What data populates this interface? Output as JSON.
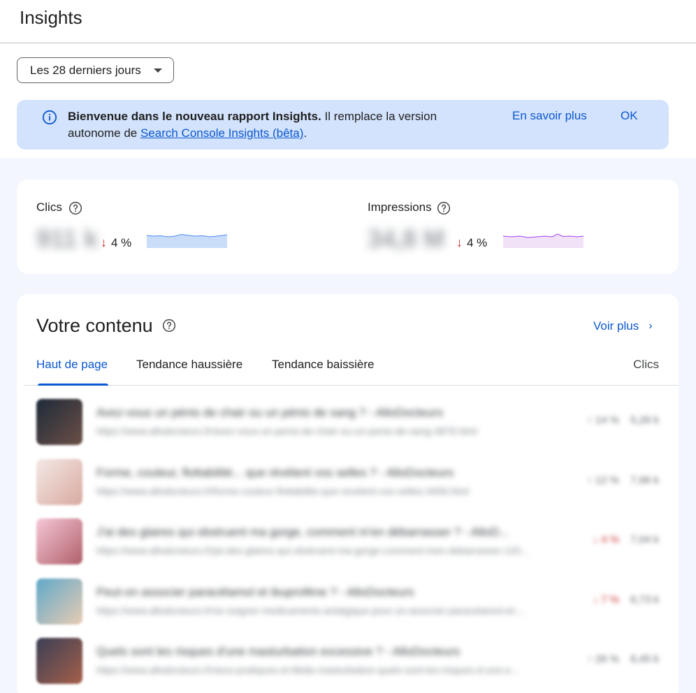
{
  "header": {
    "title": "Insights"
  },
  "filter": {
    "range_label": "Les 28 derniers jours"
  },
  "banner": {
    "bold_text": "Bienvenue dans le nouveau rapport Insights.",
    "text": " Il remplace la version autonome de ",
    "link_text": "Search Console Insights (bêta)",
    "trailing": ".",
    "learn_more": "En savoir plus",
    "ok": "OK"
  },
  "metrics": {
    "clicks": {
      "label": "Clics",
      "value": "911 k",
      "delta": "4 %",
      "direction": "down",
      "spark_color": "#c2d7f7"
    },
    "impressions": {
      "label": "Impressions",
      "value": "34,8 M",
      "delta": "4 %",
      "direction": "down",
      "spark_color": "#eedcf5"
    }
  },
  "content": {
    "title": "Votre contenu",
    "see_more": "Voir plus",
    "tabs": [
      {
        "label": "Haut de page"
      },
      {
        "label": "Tendance haussière"
      },
      {
        "label": "Tendance baissière"
      }
    ],
    "column_header": "Clics",
    "rows": [
      {
        "title": "Avez-vous un pénis de chair ou un pénis de sang ? - AlloDocteurs",
        "url": "https://www.allodocteurs.fr/avez-vous-un-penis-de-chair-ou-un-penis-de-sang-3876.html",
        "change": "↑ 14 %",
        "clicks": "5,26 k",
        "change_dir": "up",
        "thumb": [
          "#1e2a3a",
          "#6b4f45"
        ]
      },
      {
        "title": "Forme, couleur, flottabilité... que révèlent vos selles ? - AlloDocteurs",
        "url": "https://www.allodocteurs.fr/forme-couleur-flottabilite-que-revelent-vos-selles-3456.html",
        "change": "↑ 12 %",
        "clicks": "7,96 k",
        "change_dir": "up",
        "thumb": [
          "#f3e9e6",
          "#d9a9a0"
        ]
      },
      {
        "title": "J'ai des glaires qui obstruent ma gorge, comment m'en débarrasser ? - AlloD...",
        "url": "https://www.allodocteurs.fr/jai-des-glaires-qui-obstruent-ma-gorge-comment-men-debarrasser-120...",
        "change": "↓ 4 %",
        "clicks": "7,04 k",
        "change_dir": "down",
        "thumb": [
          "#f6c7d6",
          "#b0606b"
        ]
      },
      {
        "title": "Peut-on associer paracétamol et ibuprofène ? - AlloDocteurs",
        "url": "https://www.allodocteurs.fr/se-soigner-medicaments-antalgique-pour-un-associer-paracetamol-et-...",
        "change": "↓ 7 %",
        "clicks": "6,73 k",
        "change_dir": "down",
        "thumb": [
          "#5fa9c9",
          "#e8cbb3"
        ]
      },
      {
        "title": "Quels sont les risques d'une masturbation excessive ? - AlloDocteurs",
        "url": "https://www.allodocteurs.fr/sexo-pratiques-et-libido-masturbation-quels-sont-les-risques-d-une-e...",
        "change": "↑ 26 %",
        "clicks": "6,45 k",
        "change_dir": "up",
        "thumb": [
          "#3a3f55",
          "#a55f4a"
        ]
      }
    ]
  }
}
